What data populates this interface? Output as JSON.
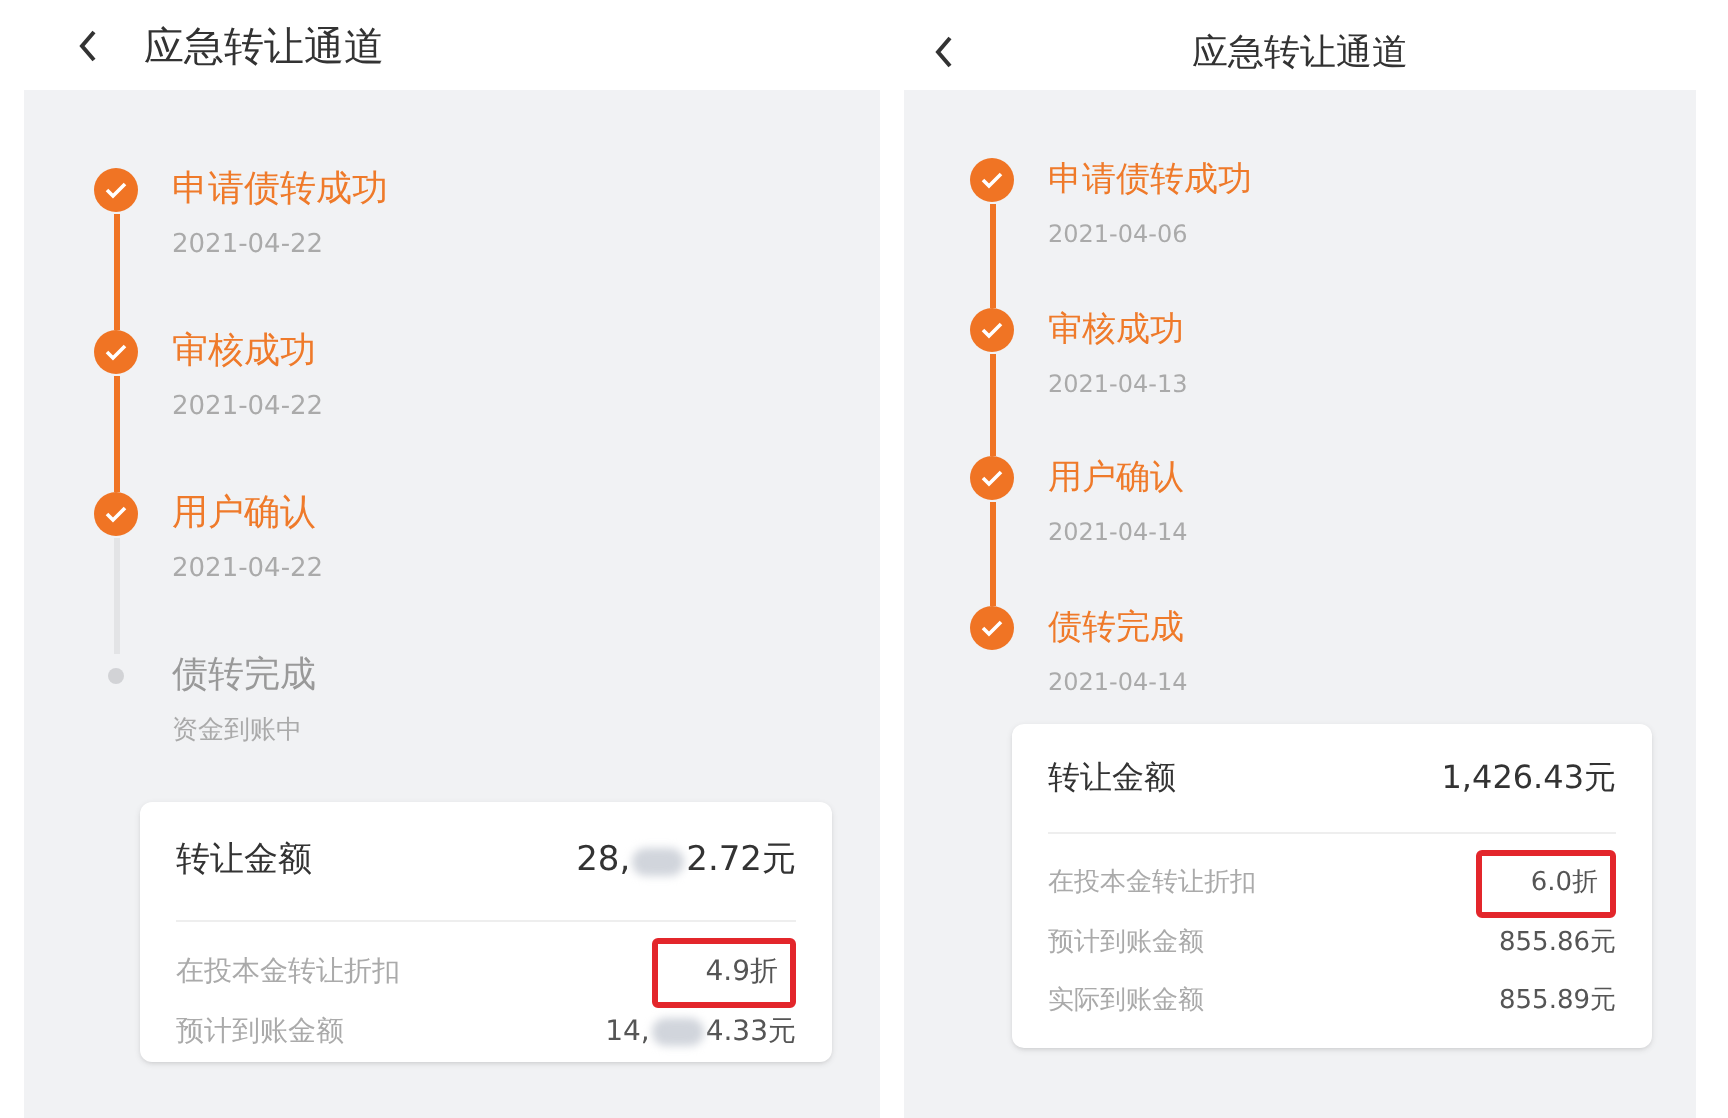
{
  "panels": [
    {
      "kind": "left-title",
      "header": {
        "title": "应急转让通道"
      },
      "steps": [
        {
          "title": "申请债转成功",
          "sub": "2021-04-22",
          "done": true
        },
        {
          "title": "审核成功",
          "sub": "2021-04-22",
          "done": true
        },
        {
          "title": "用户确认",
          "sub": "2021-04-22",
          "done": true
        },
        {
          "title": "债转完成",
          "sub": "资金到账中",
          "done": false
        }
      ],
      "card": {
        "total": {
          "label": "转让金额",
          "value_parts": [
            "28,",
            "2.72元"
          ]
        },
        "rows": [
          {
            "label": "在投本金转让折扣",
            "value_parts": [
              "4.9折"
            ],
            "highlighted": true
          },
          {
            "label": "预计到账金额",
            "value_parts": [
              "14,",
              "4.33元"
            ],
            "highlighted": false
          }
        ]
      }
    },
    {
      "kind": "centered-title",
      "header": {
        "title": "应急转让通道"
      },
      "steps": [
        {
          "title": "申请债转成功",
          "sub": "2021-04-06",
          "done": true
        },
        {
          "title": "审核成功",
          "sub": "2021-04-13",
          "done": true
        },
        {
          "title": "用户确认",
          "sub": "2021-04-14",
          "done": true
        },
        {
          "title": "债转完成",
          "sub": "2021-04-14",
          "done": true
        }
      ],
      "card": {
        "total": {
          "label": "转让金额",
          "value_parts": [
            "1,426.43元"
          ]
        },
        "rows": [
          {
            "label": "在投本金转让折扣",
            "value_parts": [
              "6.0折"
            ],
            "highlighted": true
          },
          {
            "label": "预计到账金额",
            "value_parts": [
              "855.86元"
            ],
            "highlighted": false
          },
          {
            "label": "实际到账金额",
            "value_parts": [
              "855.89元"
            ],
            "highlighted": false
          }
        ]
      }
    }
  ]
}
